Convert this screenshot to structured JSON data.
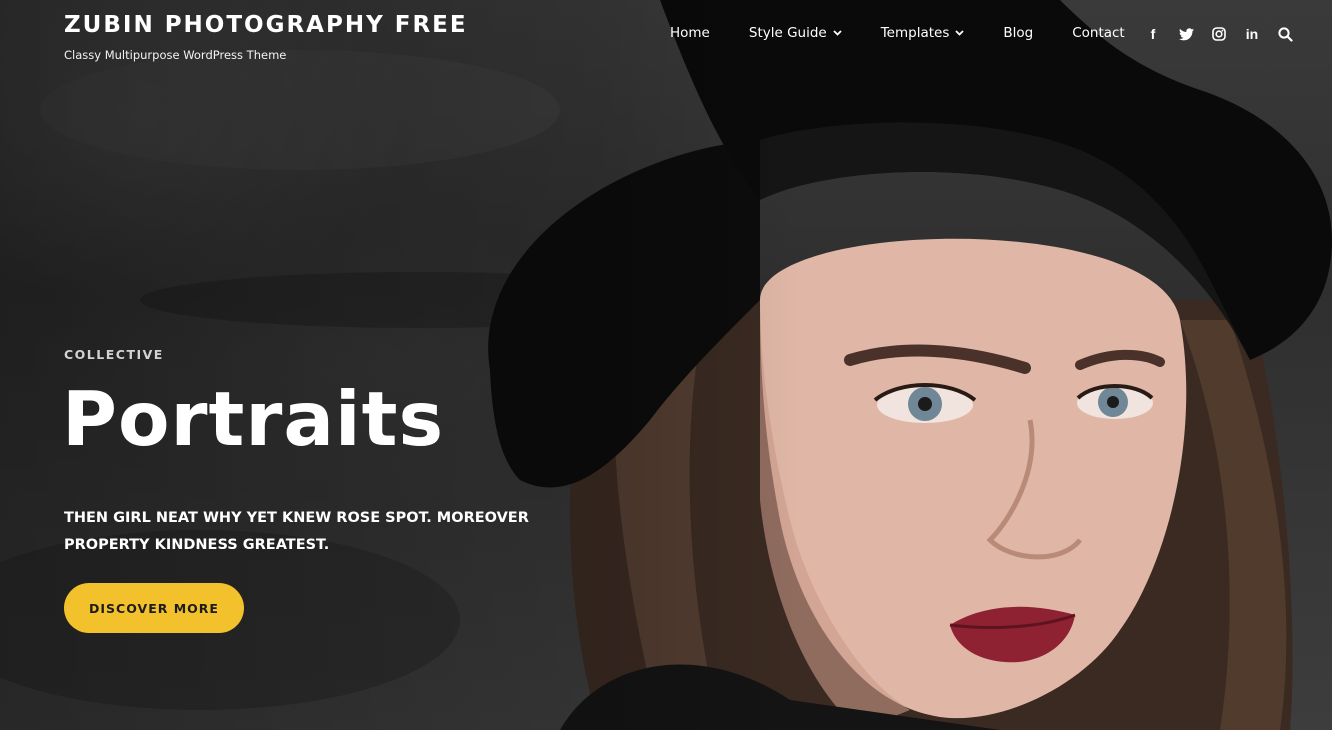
{
  "header": {
    "site_title": "ZUBIN PHOTOGRAPHY FREE",
    "tagline": "Classy Multipurpose WordPress Theme"
  },
  "nav": {
    "items": [
      {
        "label": "Home",
        "has_dropdown": false
      },
      {
        "label": "Style Guide",
        "has_dropdown": true
      },
      {
        "label": "Templates",
        "has_dropdown": true
      },
      {
        "label": "Blog",
        "has_dropdown": false
      },
      {
        "label": "Contact",
        "has_dropdown": false
      }
    ],
    "social_icons": [
      "facebook-icon",
      "twitter-icon",
      "instagram-icon",
      "linkedin-icon",
      "search-icon"
    ],
    "icon_glyphs": {
      "facebook": "f",
      "linkedin": "in"
    }
  },
  "hero": {
    "eyebrow": "COLLECTIVE",
    "headline": "Portraits",
    "subtext": "THEN GIRL NEAT WHY YET KNEW ROSE SPOT. MOREOVER PROPERTY KINDNESS GREATEST.",
    "cta_label": "DISCOVER MORE"
  },
  "colors": {
    "accent": "#f3c12b",
    "text": "#ffffff",
    "background": "#2b2b2b"
  }
}
